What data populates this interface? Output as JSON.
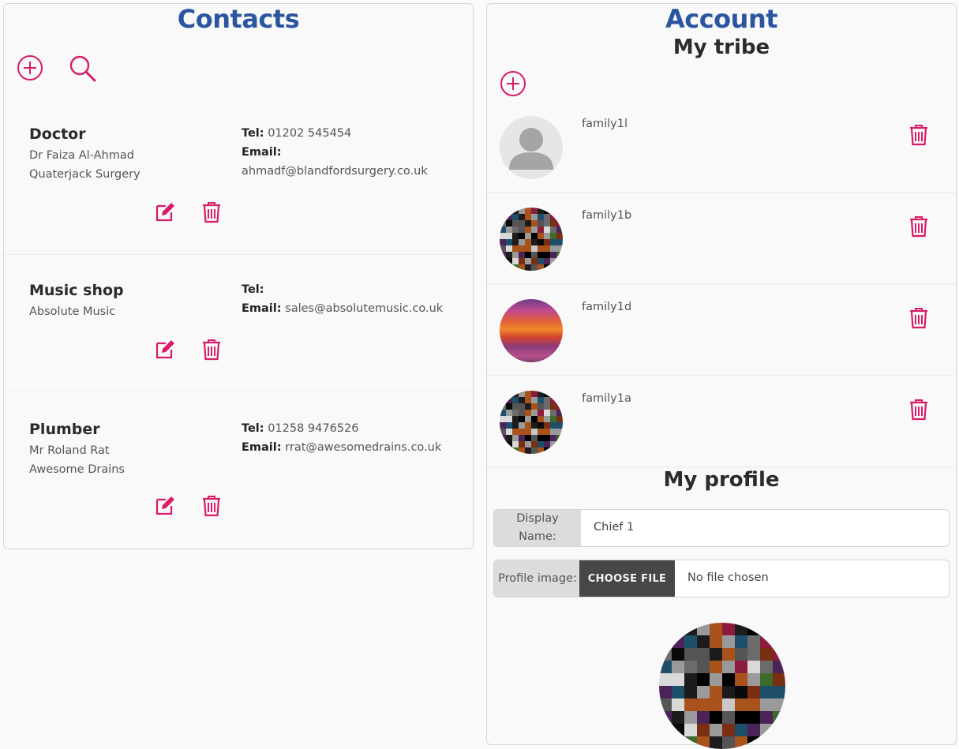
{
  "contacts": {
    "title": "Contacts",
    "add_icon": "plus-circle-icon",
    "search_icon": "search-icon",
    "tel_label": "Tel:",
    "email_label": "Email:",
    "items": [
      {
        "name": "Doctor",
        "person": "Dr Faiza Al-Ahmad",
        "org": "Quaterjack Surgery",
        "tel": "01202 545454",
        "email": "ahmadf@blandfordsurgery.co.uk"
      },
      {
        "name": "Music shop",
        "person": "",
        "org": "Absolute Music",
        "tel": "",
        "email": "sales@absolutemusic.co.uk"
      },
      {
        "name": "Plumber",
        "person": "Mr Roland Rat",
        "org": "Awesome Drains",
        "tel": "01258 9476526",
        "email": "rrat@awesomedrains.co.uk"
      }
    ]
  },
  "account": {
    "title": "Account",
    "tribe": {
      "title": "My tribe",
      "add_icon": "plus-circle-icon",
      "members": [
        {
          "name": "family1l",
          "avatar": "default-user-avatar"
        },
        {
          "name": "family1b",
          "avatar": "pixel-mosaic-avatar"
        },
        {
          "name": "family1d",
          "avatar": "sunset-abstract-avatar"
        },
        {
          "name": "family1a",
          "avatar": "pixel-mosaic-avatar"
        }
      ]
    },
    "profile": {
      "title": "My profile",
      "display_name_label": "Display Name:",
      "display_name_value": "Chief 1",
      "image_label": "Profile image:",
      "choose_file_label": "CHOOSE FILE",
      "no_file_text": "No file chosen"
    }
  },
  "colors": {
    "accent": "#d81b6a",
    "title_blue": "#2a56a0"
  }
}
